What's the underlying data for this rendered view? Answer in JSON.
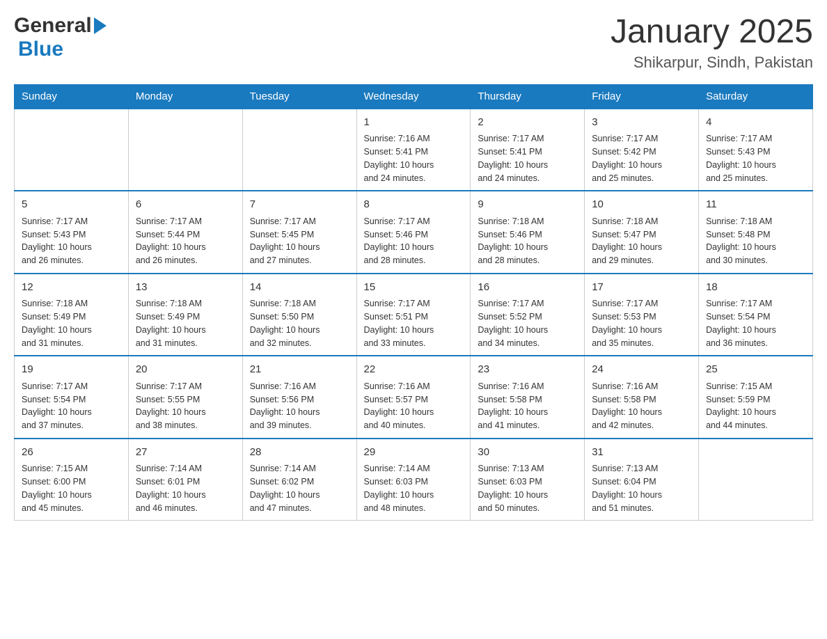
{
  "header": {
    "logo_general": "General",
    "logo_blue": "Blue",
    "month_year": "January 2025",
    "location": "Shikarpur, Sindh, Pakistan"
  },
  "days_of_week": [
    "Sunday",
    "Monday",
    "Tuesday",
    "Wednesday",
    "Thursday",
    "Friday",
    "Saturday"
  ],
  "weeks": [
    [
      {
        "day": "",
        "info": ""
      },
      {
        "day": "",
        "info": ""
      },
      {
        "day": "",
        "info": ""
      },
      {
        "day": "1",
        "info": "Sunrise: 7:16 AM\nSunset: 5:41 PM\nDaylight: 10 hours\nand 24 minutes."
      },
      {
        "day": "2",
        "info": "Sunrise: 7:17 AM\nSunset: 5:41 PM\nDaylight: 10 hours\nand 24 minutes."
      },
      {
        "day": "3",
        "info": "Sunrise: 7:17 AM\nSunset: 5:42 PM\nDaylight: 10 hours\nand 25 minutes."
      },
      {
        "day": "4",
        "info": "Sunrise: 7:17 AM\nSunset: 5:43 PM\nDaylight: 10 hours\nand 25 minutes."
      }
    ],
    [
      {
        "day": "5",
        "info": "Sunrise: 7:17 AM\nSunset: 5:43 PM\nDaylight: 10 hours\nand 26 minutes."
      },
      {
        "day": "6",
        "info": "Sunrise: 7:17 AM\nSunset: 5:44 PM\nDaylight: 10 hours\nand 26 minutes."
      },
      {
        "day": "7",
        "info": "Sunrise: 7:17 AM\nSunset: 5:45 PM\nDaylight: 10 hours\nand 27 minutes."
      },
      {
        "day": "8",
        "info": "Sunrise: 7:17 AM\nSunset: 5:46 PM\nDaylight: 10 hours\nand 28 minutes."
      },
      {
        "day": "9",
        "info": "Sunrise: 7:18 AM\nSunset: 5:46 PM\nDaylight: 10 hours\nand 28 minutes."
      },
      {
        "day": "10",
        "info": "Sunrise: 7:18 AM\nSunset: 5:47 PM\nDaylight: 10 hours\nand 29 minutes."
      },
      {
        "day": "11",
        "info": "Sunrise: 7:18 AM\nSunset: 5:48 PM\nDaylight: 10 hours\nand 30 minutes."
      }
    ],
    [
      {
        "day": "12",
        "info": "Sunrise: 7:18 AM\nSunset: 5:49 PM\nDaylight: 10 hours\nand 31 minutes."
      },
      {
        "day": "13",
        "info": "Sunrise: 7:18 AM\nSunset: 5:49 PM\nDaylight: 10 hours\nand 31 minutes."
      },
      {
        "day": "14",
        "info": "Sunrise: 7:18 AM\nSunset: 5:50 PM\nDaylight: 10 hours\nand 32 minutes."
      },
      {
        "day": "15",
        "info": "Sunrise: 7:17 AM\nSunset: 5:51 PM\nDaylight: 10 hours\nand 33 minutes."
      },
      {
        "day": "16",
        "info": "Sunrise: 7:17 AM\nSunset: 5:52 PM\nDaylight: 10 hours\nand 34 minutes."
      },
      {
        "day": "17",
        "info": "Sunrise: 7:17 AM\nSunset: 5:53 PM\nDaylight: 10 hours\nand 35 minutes."
      },
      {
        "day": "18",
        "info": "Sunrise: 7:17 AM\nSunset: 5:54 PM\nDaylight: 10 hours\nand 36 minutes."
      }
    ],
    [
      {
        "day": "19",
        "info": "Sunrise: 7:17 AM\nSunset: 5:54 PM\nDaylight: 10 hours\nand 37 minutes."
      },
      {
        "day": "20",
        "info": "Sunrise: 7:17 AM\nSunset: 5:55 PM\nDaylight: 10 hours\nand 38 minutes."
      },
      {
        "day": "21",
        "info": "Sunrise: 7:16 AM\nSunset: 5:56 PM\nDaylight: 10 hours\nand 39 minutes."
      },
      {
        "day": "22",
        "info": "Sunrise: 7:16 AM\nSunset: 5:57 PM\nDaylight: 10 hours\nand 40 minutes."
      },
      {
        "day": "23",
        "info": "Sunrise: 7:16 AM\nSunset: 5:58 PM\nDaylight: 10 hours\nand 41 minutes."
      },
      {
        "day": "24",
        "info": "Sunrise: 7:16 AM\nSunset: 5:58 PM\nDaylight: 10 hours\nand 42 minutes."
      },
      {
        "day": "25",
        "info": "Sunrise: 7:15 AM\nSunset: 5:59 PM\nDaylight: 10 hours\nand 44 minutes."
      }
    ],
    [
      {
        "day": "26",
        "info": "Sunrise: 7:15 AM\nSunset: 6:00 PM\nDaylight: 10 hours\nand 45 minutes."
      },
      {
        "day": "27",
        "info": "Sunrise: 7:14 AM\nSunset: 6:01 PM\nDaylight: 10 hours\nand 46 minutes."
      },
      {
        "day": "28",
        "info": "Sunrise: 7:14 AM\nSunset: 6:02 PM\nDaylight: 10 hours\nand 47 minutes."
      },
      {
        "day": "29",
        "info": "Sunrise: 7:14 AM\nSunset: 6:03 PM\nDaylight: 10 hours\nand 48 minutes."
      },
      {
        "day": "30",
        "info": "Sunrise: 7:13 AM\nSunset: 6:03 PM\nDaylight: 10 hours\nand 50 minutes."
      },
      {
        "day": "31",
        "info": "Sunrise: 7:13 AM\nSunset: 6:04 PM\nDaylight: 10 hours\nand 51 minutes."
      },
      {
        "day": "",
        "info": ""
      }
    ]
  ]
}
